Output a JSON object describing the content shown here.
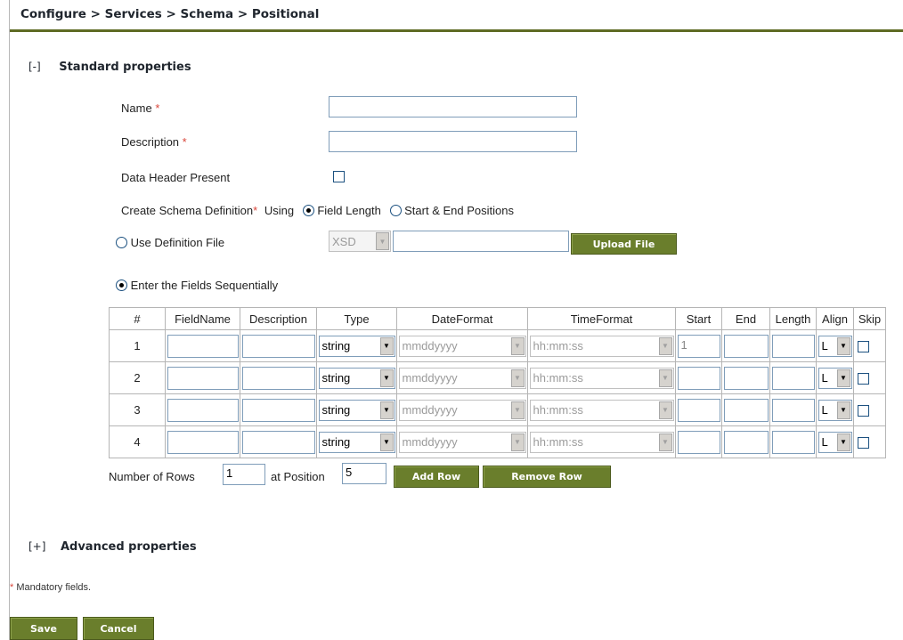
{
  "breadcrumb": "Configure > Services > Schema > Positional",
  "standard": {
    "toggle": "[-]",
    "title": "Standard properties"
  },
  "advanced": {
    "toggle": "[+]",
    "title": "Advanced properties"
  },
  "form": {
    "name_label": "Name",
    "description_label": "Description",
    "required_mark": "*",
    "data_header_label": "Data Header Present",
    "schema_def_label": "Create Schema Definition",
    "using_label": "Using",
    "field_length_label": "Field Length",
    "start_end_label": "Start & End Positions",
    "use_def_file_label": "Use Definition File",
    "def_file_type": "XSD",
    "upload_button": "Upload File",
    "enter_seq_label": "Enter the Fields Sequentially"
  },
  "table": {
    "headers": [
      "#",
      "FieldName",
      "Description",
      "Type",
      "DateFormat",
      "TimeFormat",
      "Start",
      "End",
      "Length",
      "Align",
      "Skip"
    ],
    "rows": [
      {
        "num": "1",
        "type": "string",
        "date": "mmddyyyy",
        "time": "hh:mm:ss",
        "start": "1",
        "align": "L"
      },
      {
        "num": "2",
        "type": "string",
        "date": "mmddyyyy",
        "time": "hh:mm:ss",
        "start": "",
        "align": "L"
      },
      {
        "num": "3",
        "type": "string",
        "date": "mmddyyyy",
        "time": "hh:mm:ss",
        "start": "",
        "align": "L"
      },
      {
        "num": "4",
        "type": "string",
        "date": "mmddyyyy",
        "time": "hh:mm:ss",
        "start": "",
        "align": "L"
      }
    ]
  },
  "rows_control": {
    "num_rows_label": "Number of Rows",
    "num_rows_value": "1",
    "position_label": "at Position",
    "position_value": "5",
    "add_row": "Add Row",
    "remove_row": "Remove Row"
  },
  "footnote": {
    "mark": "*",
    "text": " Mandatory fields."
  },
  "actions": {
    "save": "Save",
    "cancel": "Cancel"
  },
  "colors": {
    "accent": "#5e6b24",
    "button": "#6a7e2c",
    "required": "#d9463a"
  },
  "icons": {
    "checkbox": "checkbox-icon",
    "radio": "radio-icon",
    "dropdown": "chevron-down-icon"
  }
}
